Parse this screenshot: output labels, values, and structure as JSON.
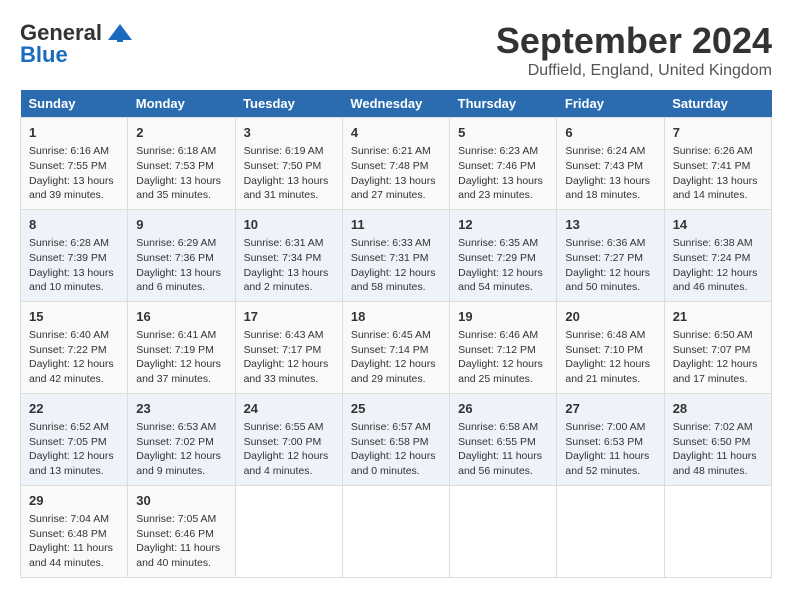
{
  "header": {
    "logo_general": "General",
    "logo_blue": "Blue",
    "title": "September 2024",
    "location": "Duffield, England, United Kingdom"
  },
  "weekdays": [
    "Sunday",
    "Monday",
    "Tuesday",
    "Wednesday",
    "Thursday",
    "Friday",
    "Saturday"
  ],
  "weeks": [
    [
      {
        "day": 1,
        "info": "Sunrise: 6:16 AM\nSunset: 7:55 PM\nDaylight: 13 hours\nand 39 minutes."
      },
      {
        "day": 2,
        "info": "Sunrise: 6:18 AM\nSunset: 7:53 PM\nDaylight: 13 hours\nand 35 minutes."
      },
      {
        "day": 3,
        "info": "Sunrise: 6:19 AM\nSunset: 7:50 PM\nDaylight: 13 hours\nand 31 minutes."
      },
      {
        "day": 4,
        "info": "Sunrise: 6:21 AM\nSunset: 7:48 PM\nDaylight: 13 hours\nand 27 minutes."
      },
      {
        "day": 5,
        "info": "Sunrise: 6:23 AM\nSunset: 7:46 PM\nDaylight: 13 hours\nand 23 minutes."
      },
      {
        "day": 6,
        "info": "Sunrise: 6:24 AM\nSunset: 7:43 PM\nDaylight: 13 hours\nand 18 minutes."
      },
      {
        "day": 7,
        "info": "Sunrise: 6:26 AM\nSunset: 7:41 PM\nDaylight: 13 hours\nand 14 minutes."
      }
    ],
    [
      {
        "day": 8,
        "info": "Sunrise: 6:28 AM\nSunset: 7:39 PM\nDaylight: 13 hours\nand 10 minutes."
      },
      {
        "day": 9,
        "info": "Sunrise: 6:29 AM\nSunset: 7:36 PM\nDaylight: 13 hours\nand 6 minutes."
      },
      {
        "day": 10,
        "info": "Sunrise: 6:31 AM\nSunset: 7:34 PM\nDaylight: 13 hours\nand 2 minutes."
      },
      {
        "day": 11,
        "info": "Sunrise: 6:33 AM\nSunset: 7:31 PM\nDaylight: 12 hours\nand 58 minutes."
      },
      {
        "day": 12,
        "info": "Sunrise: 6:35 AM\nSunset: 7:29 PM\nDaylight: 12 hours\nand 54 minutes."
      },
      {
        "day": 13,
        "info": "Sunrise: 6:36 AM\nSunset: 7:27 PM\nDaylight: 12 hours\nand 50 minutes."
      },
      {
        "day": 14,
        "info": "Sunrise: 6:38 AM\nSunset: 7:24 PM\nDaylight: 12 hours\nand 46 minutes."
      }
    ],
    [
      {
        "day": 15,
        "info": "Sunrise: 6:40 AM\nSunset: 7:22 PM\nDaylight: 12 hours\nand 42 minutes."
      },
      {
        "day": 16,
        "info": "Sunrise: 6:41 AM\nSunset: 7:19 PM\nDaylight: 12 hours\nand 37 minutes."
      },
      {
        "day": 17,
        "info": "Sunrise: 6:43 AM\nSunset: 7:17 PM\nDaylight: 12 hours\nand 33 minutes."
      },
      {
        "day": 18,
        "info": "Sunrise: 6:45 AM\nSunset: 7:14 PM\nDaylight: 12 hours\nand 29 minutes."
      },
      {
        "day": 19,
        "info": "Sunrise: 6:46 AM\nSunset: 7:12 PM\nDaylight: 12 hours\nand 25 minutes."
      },
      {
        "day": 20,
        "info": "Sunrise: 6:48 AM\nSunset: 7:10 PM\nDaylight: 12 hours\nand 21 minutes."
      },
      {
        "day": 21,
        "info": "Sunrise: 6:50 AM\nSunset: 7:07 PM\nDaylight: 12 hours\nand 17 minutes."
      }
    ],
    [
      {
        "day": 22,
        "info": "Sunrise: 6:52 AM\nSunset: 7:05 PM\nDaylight: 12 hours\nand 13 minutes."
      },
      {
        "day": 23,
        "info": "Sunrise: 6:53 AM\nSunset: 7:02 PM\nDaylight: 12 hours\nand 9 minutes."
      },
      {
        "day": 24,
        "info": "Sunrise: 6:55 AM\nSunset: 7:00 PM\nDaylight: 12 hours\nand 4 minutes."
      },
      {
        "day": 25,
        "info": "Sunrise: 6:57 AM\nSunset: 6:58 PM\nDaylight: 12 hours\nand 0 minutes."
      },
      {
        "day": 26,
        "info": "Sunrise: 6:58 AM\nSunset: 6:55 PM\nDaylight: 11 hours\nand 56 minutes."
      },
      {
        "day": 27,
        "info": "Sunrise: 7:00 AM\nSunset: 6:53 PM\nDaylight: 11 hours\nand 52 minutes."
      },
      {
        "day": 28,
        "info": "Sunrise: 7:02 AM\nSunset: 6:50 PM\nDaylight: 11 hours\nand 48 minutes."
      }
    ],
    [
      {
        "day": 29,
        "info": "Sunrise: 7:04 AM\nSunset: 6:48 PM\nDaylight: 11 hours\nand 44 minutes."
      },
      {
        "day": 30,
        "info": "Sunrise: 7:05 AM\nSunset: 6:46 PM\nDaylight: 11 hours\nand 40 minutes."
      },
      null,
      null,
      null,
      null,
      null
    ]
  ]
}
